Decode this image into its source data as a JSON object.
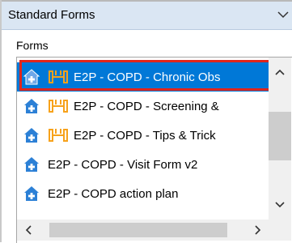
{
  "dropdown": {
    "value": "Standard Forms",
    "icon": "chevron-down-icon"
  },
  "forms_header": "Forms",
  "list": {
    "items": [
      {
        "label": "E2P - COPD - Chronic Obs",
        "has_dumbbell": true,
        "selected": true
      },
      {
        "label": "E2P - COPD - Screening &",
        "has_dumbbell": true,
        "selected": false
      },
      {
        "label": "E2P - COPD - Tips & Trick",
        "has_dumbbell": true,
        "selected": false
      },
      {
        "label": "E2P - COPD - Visit Form v2",
        "has_dumbbell": false,
        "selected": false
      },
      {
        "label": "E2P - COPD action plan",
        "has_dumbbell": false,
        "selected": false
      }
    ]
  },
  "colors": {
    "selection": "#0078d7",
    "highlight_border": "#e1251b",
    "house_icon": "#2c80d6",
    "dumbbell_icon": "#f7a21b"
  },
  "icons": {
    "house": "house-plus-icon",
    "dumbbell": "dumbbell-icon",
    "scroll_up": "arrow-up-icon",
    "scroll_down": "arrow-down-icon",
    "scroll_left": "arrow-left-icon",
    "scroll_right": "arrow-right-icon"
  }
}
